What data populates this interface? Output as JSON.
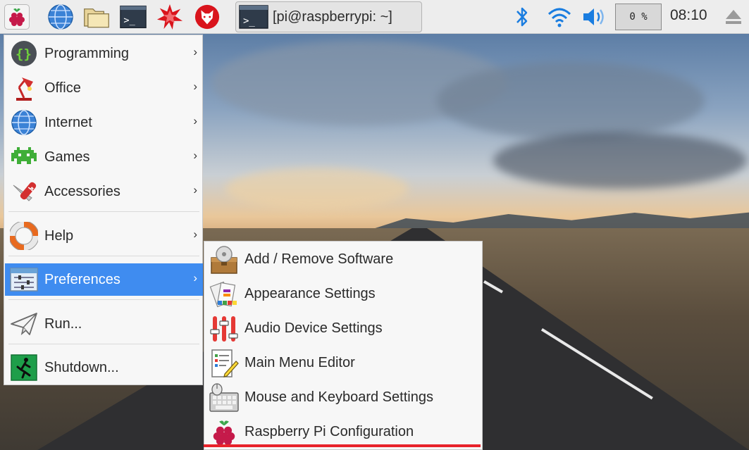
{
  "panel": {
    "launcher_icon": "raspberry-pi-menu-icon",
    "quicklaunch": [
      {
        "name": "web-browser-icon"
      },
      {
        "name": "file-manager-icon"
      },
      {
        "name": "terminal-icon"
      },
      {
        "name": "mathematica-icon"
      },
      {
        "name": "wolfram-icon"
      }
    ],
    "taskbar_window": {
      "label": "[pi@raspberrypi: ~]",
      "icon": "terminal-icon"
    },
    "tray": {
      "bluetooth_icon": "bluetooth-icon",
      "wifi_icon": "wifi-icon",
      "volume_icon": "volume-icon",
      "cpu": "0 %",
      "clock": "08:10",
      "eject_icon": "eject-icon"
    }
  },
  "main_menu": {
    "items": [
      {
        "label": "Programming",
        "icon": "programming-icon",
        "has_submenu": true
      },
      {
        "label": "Office",
        "icon": "office-icon",
        "has_submenu": true
      },
      {
        "label": "Internet",
        "icon": "internet-globe-icon",
        "has_submenu": true
      },
      {
        "label": "Games",
        "icon": "games-invader-icon",
        "has_submenu": true
      },
      {
        "label": "Accessories",
        "icon": "accessories-knife-icon",
        "has_submenu": true
      },
      {
        "label": "Help",
        "icon": "help-lifebuoy-icon",
        "has_submenu": true
      },
      {
        "label": "Preferences",
        "icon": "preferences-icon",
        "has_submenu": true,
        "active": true
      },
      {
        "label": "Run...",
        "icon": "run-paper-plane-icon",
        "has_submenu": false
      },
      {
        "label": "Shutdown...",
        "icon": "shutdown-exit-icon",
        "has_submenu": false
      }
    ],
    "arrow": "›"
  },
  "preferences_submenu": {
    "items": [
      {
        "label": "Add / Remove Software",
        "icon": "software-package-icon"
      },
      {
        "label": "Appearance Settings",
        "icon": "appearance-palette-icon"
      },
      {
        "label": "Audio Device Settings",
        "icon": "audio-sliders-icon"
      },
      {
        "label": "Main Menu Editor",
        "icon": "menu-editor-icon"
      },
      {
        "label": "Mouse and Keyboard Settings",
        "icon": "mouse-keyboard-icon"
      },
      {
        "label": "Raspberry Pi Configuration",
        "icon": "raspberry-pi-config-icon"
      }
    ]
  },
  "colors": {
    "menu_highlight": "#3f8cf0",
    "annotation_underline": "#e8222a",
    "panel_bg": "#ededed"
  }
}
